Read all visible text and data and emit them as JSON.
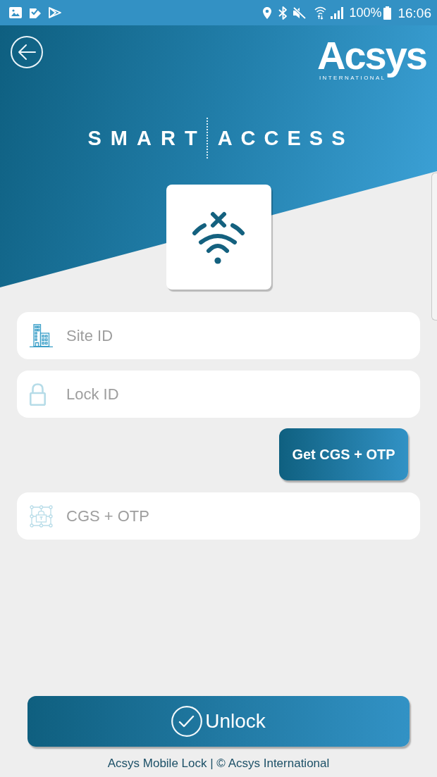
{
  "status_bar": {
    "battery": "100%",
    "time": "16:06"
  },
  "header": {
    "logo": {
      "wordmark": "Acsys",
      "tagline": "INTERNATIONAL"
    },
    "title": {
      "left": "SMART",
      "right": "ACCESS"
    }
  },
  "connection": {
    "connected": false
  },
  "form": {
    "site_id": {
      "placeholder": "Site ID"
    },
    "lock_id": {
      "placeholder": "Lock ID"
    },
    "get_code_button": "Get CGS + OTP",
    "code": {
      "placeholder": "CGS + OTP"
    }
  },
  "unlock_button": "Unlock",
  "footer": "Acsys Mobile Lock | © Acsys International"
}
